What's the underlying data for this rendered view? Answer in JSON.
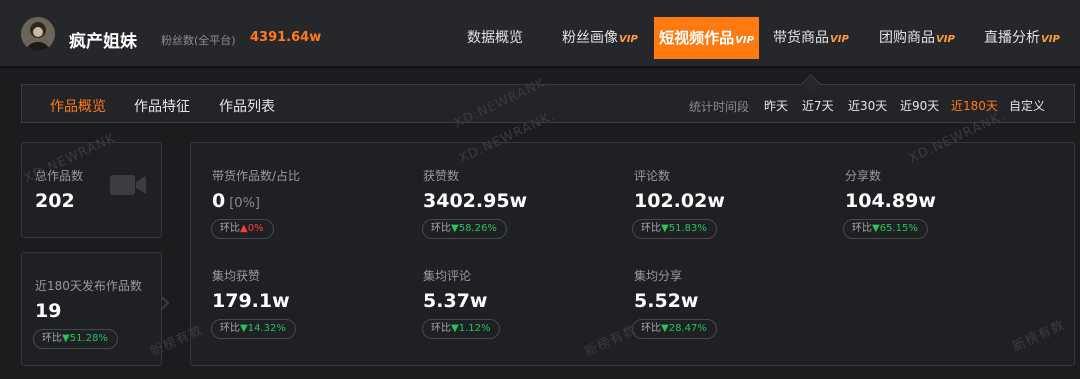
{
  "account": {
    "name": "疯产姐妹",
    "fans_label": "粉丝数(全平台)",
    "fans_value": "4391.64w"
  },
  "nav": {
    "vip_label": "VIP",
    "items": [
      {
        "label": "数据概览"
      },
      {
        "label": "粉丝画像",
        "vip": true
      },
      {
        "label": "短视频作品",
        "vip": true,
        "active": true
      },
      {
        "label": "带货商品",
        "vip": true
      },
      {
        "label": "团购商品",
        "vip": true
      },
      {
        "label": "直播分析",
        "vip": true
      }
    ]
  },
  "subtabs": [
    "作品概览",
    "作品特征",
    "作品列表"
  ],
  "time_range": {
    "label": "统计时间段",
    "options": [
      "昨天",
      "近7天",
      "近30天",
      "近90天",
      "近180天",
      "自定义"
    ],
    "selected": "近180天"
  },
  "summary": {
    "total": {
      "label": "总作品数",
      "value": "202"
    },
    "recent": {
      "label": "近180天发布作品数",
      "value": "19",
      "change_label": "环比",
      "change": "51.28%",
      "direction": "down"
    }
  },
  "metrics": [
    {
      "label": "带货作品数/占比",
      "value": "0",
      "extra": "[0%]",
      "change_label": "环比",
      "change": "0%",
      "direction": "up"
    },
    {
      "label": "获赞数",
      "value": "3402.95w",
      "change_label": "环比",
      "change": "58.26%",
      "direction": "down"
    },
    {
      "label": "评论数",
      "value": "102.02w",
      "change_label": "环比",
      "change": "51.83%",
      "direction": "down"
    },
    {
      "label": "分享数",
      "value": "104.89w",
      "change_label": "环比",
      "change": "65.15%",
      "direction": "down"
    },
    {
      "label": "集均获赞",
      "value": "179.1w",
      "change_label": "环比",
      "change": "14.32%",
      "direction": "down"
    },
    {
      "label": "集均评论",
      "value": "5.37w",
      "change_label": "环比",
      "change": "1.12%",
      "direction": "down"
    },
    {
      "label": "集均分享",
      "value": "5.52w",
      "change_label": "环比",
      "change": "28.47%",
      "direction": "down"
    }
  ],
  "watermark_text": [
    "XD.NEWRANK.",
    "新榜有数"
  ],
  "colors": {
    "accent": "#ff7a10",
    "up": "#ff3b3b",
    "down": "#22c55e",
    "background": "#1b1c1e"
  },
  "icons": {
    "video": "video-camera-icon",
    "arrow_up": "▲",
    "arrow_down": "▼"
  }
}
